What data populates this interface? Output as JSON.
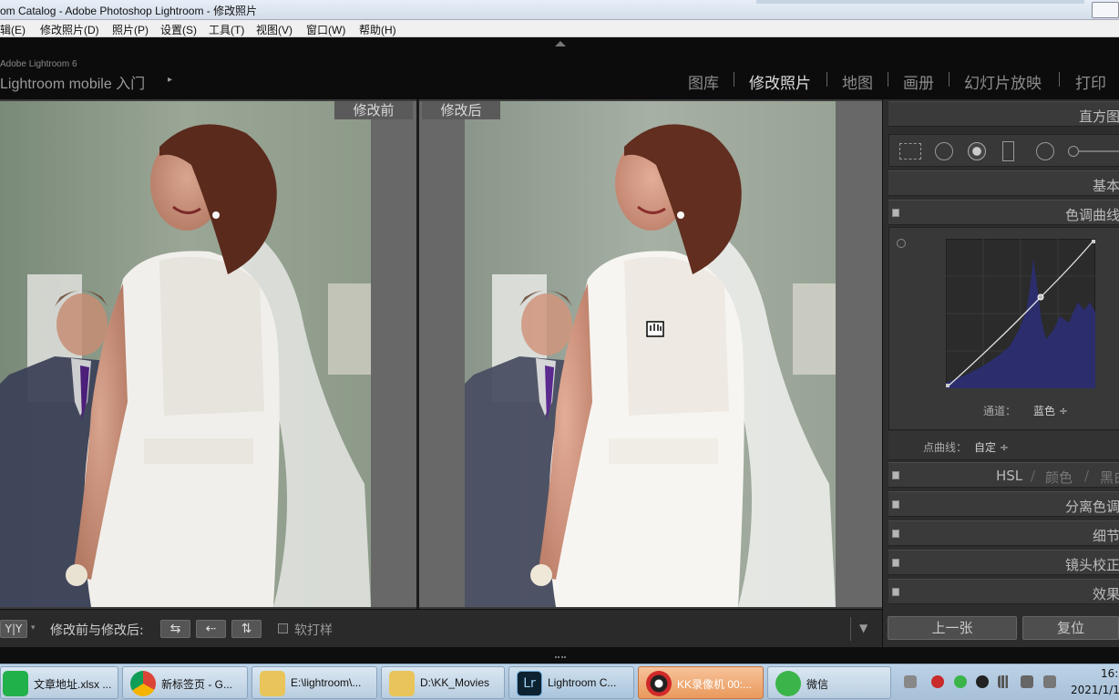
{
  "window": {
    "title": "om Catalog - Adobe Photoshop Lightroom - 修改照片"
  },
  "menu": [
    "辑(E)",
    "修改照片(D)",
    "照片(P)",
    "设置(S)",
    "工具(T)",
    "视图(V)",
    "窗口(W)",
    "帮助(H)"
  ],
  "header": {
    "brand_line1": "Adobe Lightroom 6",
    "brand_line2": "Lightroom mobile 入门",
    "brand_arrow": "▸",
    "modules": [
      "图库",
      "修改照片",
      "地图",
      "画册",
      "幻灯片放映",
      "打印"
    ],
    "active_module": "修改照片"
  },
  "compare": {
    "before_label": "修改前",
    "after_label": "修改后"
  },
  "toolbar": {
    "view_mode": "Y|Y",
    "compare_label": "修改前与修改后:",
    "soft_proof_label": "软打样",
    "btn1": "⇆",
    "btn2": "⇠",
    "btn3": "⇅"
  },
  "panel": {
    "histogram_label": "直方图",
    "basic_label": "基本",
    "tone_curve_label": "色调曲线",
    "channel_label": "通道：",
    "channel_value": "蓝色 ÷",
    "point_curve_label": "点曲线：",
    "point_curve_value": "自定 ÷",
    "hsl_label": "HSL",
    "hsl_sep": "/",
    "color_label": "颜色",
    "bw_label": "黑白",
    "split_tone_label": "分离色调",
    "detail_label": "细节",
    "lens_label": "镜头校正",
    "effects_label": "效果",
    "prev_button": "上一张",
    "reset_button": "复位"
  },
  "taskbar": {
    "items": [
      "文章地址.xlsx ...",
      "新标签页 - G...",
      "E:\\lightroom\\...",
      "D:\\KK_Movies",
      "Lightroom C...",
      "KK录像机 00:...",
      "微信"
    ],
    "clock_time": "16:",
    "clock_date": "2021/1/1"
  },
  "colors": {
    "accent_orange": "#e99a5c",
    "panel_bg": "#2d2d2d",
    "curve_line": "#dcdcdc",
    "histogram_blue": "#2a2a6e"
  }
}
